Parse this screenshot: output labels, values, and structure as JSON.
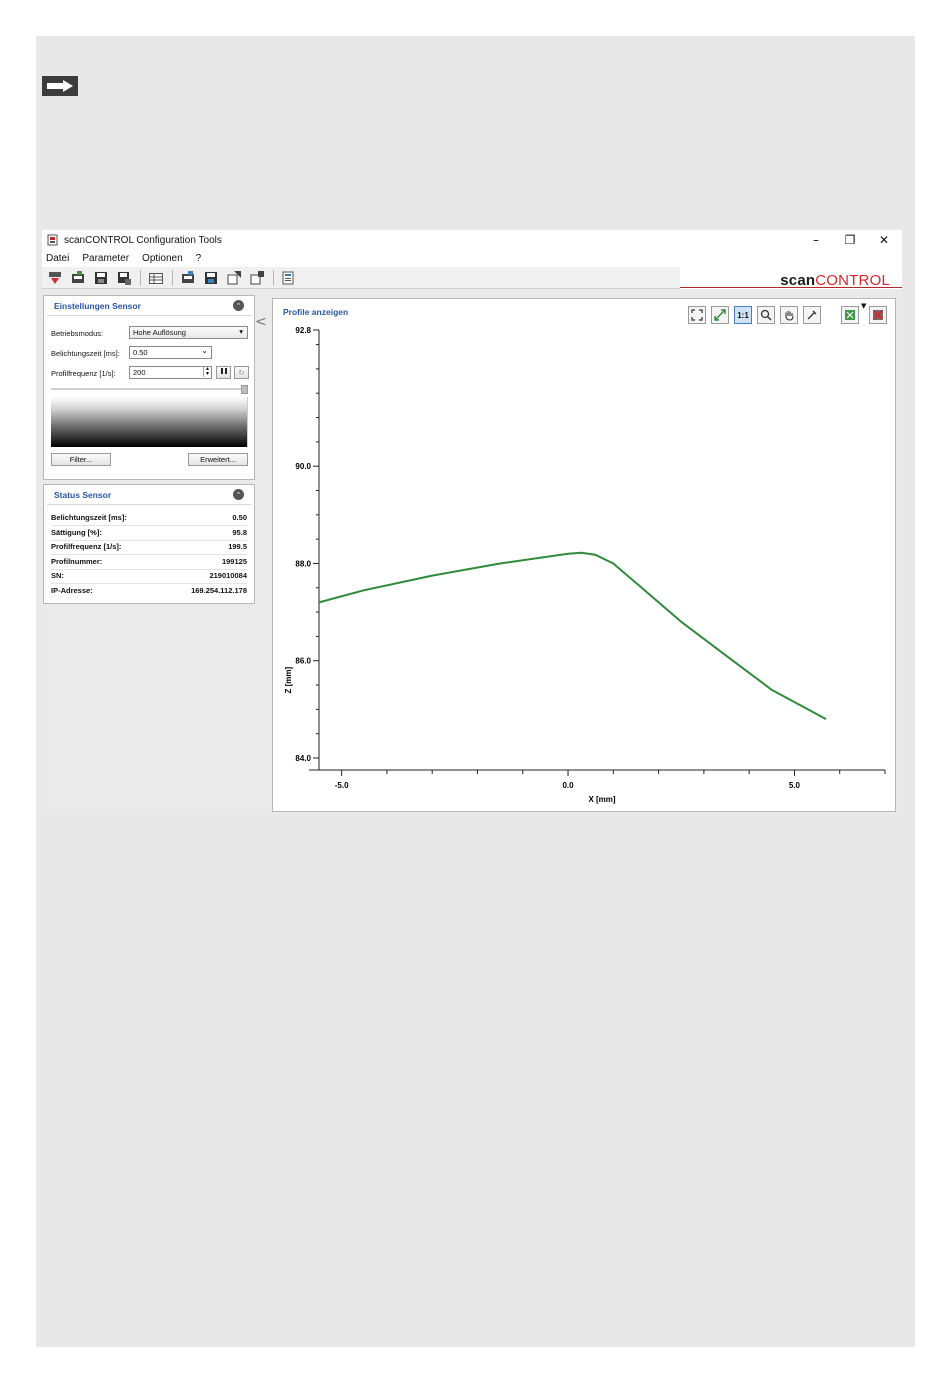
{
  "window": {
    "title": "scanCONTROL Configuration Tools",
    "controls": [
      "–",
      "❐",
      "✕"
    ]
  },
  "menu": [
    "Datei",
    "Parameter",
    "Optionen",
    "?"
  ],
  "brand": {
    "part1": "scan",
    "part2": "CONTROL",
    "color_accent": "#d9262e"
  },
  "settings_panel": {
    "title": "Einstellungen Sensor",
    "betriebsmodus_label": "Betriebsmodus:",
    "betriebsmodus_value": "Hohe Auflösung",
    "belichtung_label": "Belichtungszeit [ms]:",
    "belichtung_value": "0.50",
    "profilfreq_label": "Profilfrequenz [1/s]:",
    "profilfreq_value": "200",
    "filter_button": "Filter...",
    "erweitert_button": "Erweitert..."
  },
  "status_panel": {
    "title": "Status Sensor",
    "rows": [
      {
        "label": "Belichtungszeit [ms]:",
        "value": "0.50"
      },
      {
        "label": "Sättigung [%]:",
        "value": "95.8"
      },
      {
        "label": "Profilfrequenz [1/s]:",
        "value": "199.5"
      },
      {
        "label": "Profilnummer:",
        "value": "199125"
      },
      {
        "label": "SN:",
        "value": "219010084"
      },
      {
        "label": "IP-Adresse:",
        "value": "169.254.112.178"
      }
    ]
  },
  "plot": {
    "title": "Profile anzeigen",
    "tool_one_to_one": "1:1"
  },
  "chart_data": {
    "type": "line",
    "xlabel": "X [mm]",
    "ylabel": "Z [mm]",
    "xlim": [
      -5.5,
      7.0
    ],
    "ylim": [
      84.0,
      92.8
    ],
    "x_ticks": [
      -5.0,
      0.0,
      5.0
    ],
    "y_ticks": [
      84.0,
      86.0,
      88.0,
      90.0,
      92.8
    ],
    "x_tick_labels": [
      "-5.0",
      "0.0",
      "5.0"
    ],
    "y_tick_labels": [
      "84.0",
      "86.0",
      "88.0",
      "90.0",
      "92.8"
    ],
    "series": [
      {
        "color": "#2e8b3a",
        "x": [
          -5.5,
          -4.5,
          -3.0,
          -1.5,
          0.0,
          0.3,
          0.6,
          1.0,
          1.5,
          2.5,
          3.5,
          4.5,
          5.7
        ],
        "y": [
          87.2,
          87.45,
          87.75,
          88.0,
          88.2,
          88.22,
          88.18,
          88.0,
          87.6,
          86.8,
          86.1,
          85.4,
          84.8
        ]
      }
    ],
    "grid": false
  }
}
